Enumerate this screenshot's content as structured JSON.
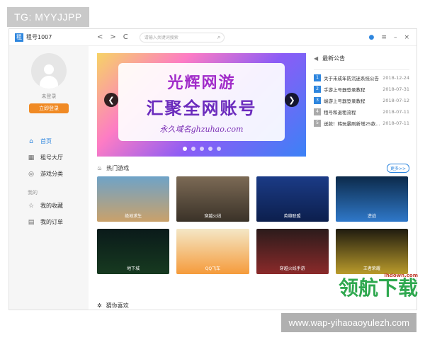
{
  "watermark_top": "TG: MYYJJPP",
  "app": {
    "name": "租号1007",
    "nav": {
      "back": "<",
      "forward": ">",
      "refresh": "C"
    },
    "search_placeholder": "请输入关键词搜索",
    "window": {
      "user": "●",
      "menu": "≡",
      "minimize": "–",
      "close": "×"
    }
  },
  "sidebar": {
    "status": "未登录",
    "login_button": "立即登录",
    "items": [
      {
        "icon": "home-icon",
        "label": "首页"
      },
      {
        "icon": "hall-icon",
        "label": "租号大厅"
      },
      {
        "icon": "category-icon",
        "label": "游戏分类"
      }
    ],
    "mine_label": "我的",
    "mine_items": [
      {
        "icon": "star-icon",
        "label": "我的收藏"
      },
      {
        "icon": "order-icon",
        "label": "我的订单"
      }
    ]
  },
  "banner": {
    "line1": "光辉网游",
    "line2": "汇聚全网账号",
    "line3": "永久域名ghzuhao.com"
  },
  "notice": {
    "title": "最新公告",
    "rows": [
      {
        "n": "1",
        "text": "关于未成年防沉迷系统公告",
        "date": "2018-12-24"
      },
      {
        "n": "2",
        "text": "手游上号器登录教程",
        "date": "2018-07-31"
      },
      {
        "n": "3",
        "text": "端游上号器登录教程",
        "date": "2018-07-12"
      },
      {
        "n": "4",
        "text": "租号和退租流程",
        "date": "2018-07-11"
      },
      {
        "n": "5",
        "text": "送款！韩玩暴刷新增25款...",
        "date": "2018-07-11"
      }
    ]
  },
  "hot": {
    "title": "热门游戏",
    "more": "更多>>",
    "games": [
      "绝地求生",
      "穿越火线",
      "英雄联盟",
      "逆战",
      "地下城",
      "QQ飞车",
      "穿越火线手游",
      "王者荣耀"
    ]
  },
  "guess": {
    "title": "猜你喜欢"
  },
  "watermark_site": {
    "domain": "lhdown.com",
    "name": "领航下载"
  },
  "watermark_url": "www.wap-yihaoaoyulezh.com"
}
